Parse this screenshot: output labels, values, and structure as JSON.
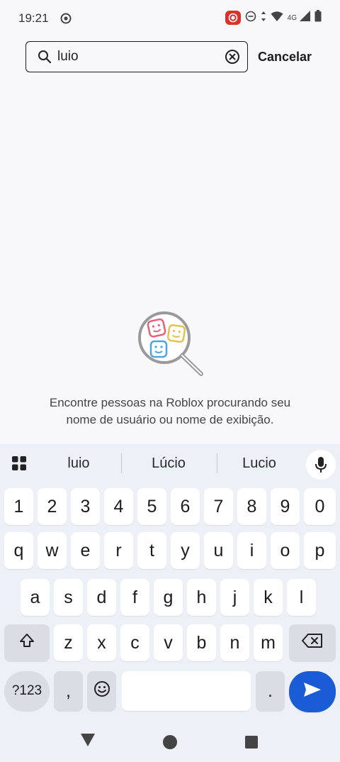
{
  "status_bar": {
    "time": "19:21",
    "network": "4G"
  },
  "search": {
    "value": "luio",
    "cancel_label": "Cancelar"
  },
  "empty_state": {
    "line1": "Encontre pessoas na Roblox procurando seu",
    "line2": "nome de usuário ou nome de exibição."
  },
  "keyboard": {
    "suggestions": [
      "luio",
      "Lúcio",
      "Lucio"
    ],
    "row_numbers": [
      "1",
      "2",
      "3",
      "4",
      "5",
      "6",
      "7",
      "8",
      "9",
      "0"
    ],
    "row1": [
      "q",
      "w",
      "e",
      "r",
      "t",
      "y",
      "u",
      "i",
      "o",
      "p"
    ],
    "row2": [
      "a",
      "s",
      "d",
      "f",
      "g",
      "h",
      "j",
      "k",
      "l"
    ],
    "row3": [
      "z",
      "x",
      "c",
      "v",
      "b",
      "n",
      "m"
    ],
    "symbols_label": "?123",
    "comma": ",",
    "period": "."
  },
  "colors": {
    "accent": "#1a5bd6",
    "record": "#d9322b"
  }
}
